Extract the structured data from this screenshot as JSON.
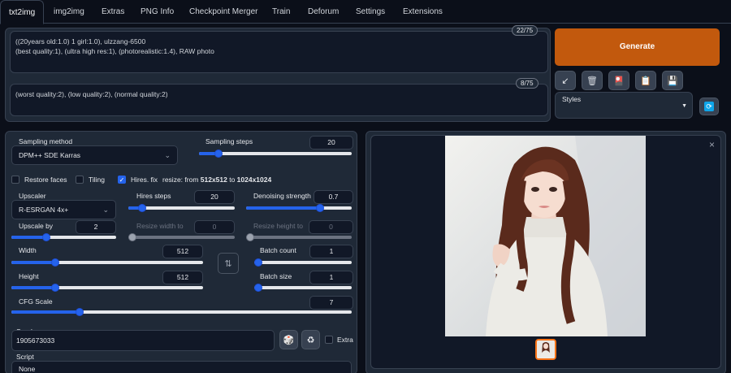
{
  "tabs": [
    {
      "label": "txt2img"
    },
    {
      "label": "img2img"
    },
    {
      "label": "Extras"
    },
    {
      "label": "PNG Info"
    },
    {
      "label": "Checkpoint Merger"
    },
    {
      "label": "Train"
    },
    {
      "label": "Deforum"
    },
    {
      "label": "Settings"
    },
    {
      "label": "Extensions"
    }
  ],
  "prompt": {
    "value": "((20years old:1.0) 1 girl:1.0), ulzzang-6500\n(best quality:1), (ultra high res:1), (photorealistic:1.4), RAW photo",
    "counter": "22/75"
  },
  "negative_prompt": {
    "value": "(worst quality:2), (low quality:2), (normal quality:2)",
    "counter": "8/75"
  },
  "generate_label": "Generate",
  "tools": [
    {
      "icon": "brush-icon",
      "glyph": "↙"
    },
    {
      "icon": "trash-icon",
      "glyph": "🗑"
    },
    {
      "icon": "style-icon",
      "glyph": "🎴"
    },
    {
      "icon": "clipboard-icon",
      "glyph": "📋"
    },
    {
      "icon": "save-icon",
      "glyph": "💾"
    }
  ],
  "styles": {
    "label": "Styles",
    "value": ""
  },
  "sampling_method": {
    "label": "Sampling method",
    "value": "DPM++ SDE Karras"
  },
  "sampling_steps": {
    "label": "Sampling steps",
    "value": "20",
    "fraction": 0.13
  },
  "checks": {
    "restore_faces": {
      "label": "Restore faces",
      "checked": false
    },
    "tiling": {
      "label": "Tiling",
      "checked": false
    },
    "hires_fix": {
      "label": "Hires. fix",
      "checked": true
    }
  },
  "resize_text": {
    "prefix": "resize: from ",
    "from": "512x512",
    "to_word": " to ",
    "to": "1024x1024"
  },
  "upscaler": {
    "label": "Upscaler",
    "value": "R-ESRGAN 4x+"
  },
  "hires_steps": {
    "label": "Hires steps",
    "value": "20",
    "fraction": 0.13
  },
  "denoising": {
    "label": "Denoising strength",
    "value": "0.7",
    "fraction": 0.7
  },
  "upscale_by": {
    "label": "Upscale by",
    "value": "2",
    "fraction": 0.33
  },
  "resize_width": {
    "label": "Resize width to",
    "value": "0",
    "fraction": 0.0
  },
  "resize_height": {
    "label": "Resize height to",
    "value": "0",
    "fraction": 0.0
  },
  "width": {
    "label": "Width",
    "value": "512",
    "fraction": 0.23
  },
  "height": {
    "label": "Height",
    "value": "512",
    "fraction": 0.23
  },
  "batch_count": {
    "label": "Batch count",
    "value": "1",
    "fraction": 0.0
  },
  "batch_size": {
    "label": "Batch size",
    "value": "1",
    "fraction": 0.0
  },
  "cfg_scale": {
    "label": "CFG Scale",
    "value": "7",
    "fraction": 0.2
  },
  "seed": {
    "label": "Seed",
    "value": "1905673033",
    "extra_label": "Extra"
  },
  "script": {
    "label": "Script",
    "value": "None"
  },
  "swap_glyph": "⇅",
  "dice_glyph": "🎲",
  "recycle_glyph": "♻",
  "close_glyph": "×"
}
